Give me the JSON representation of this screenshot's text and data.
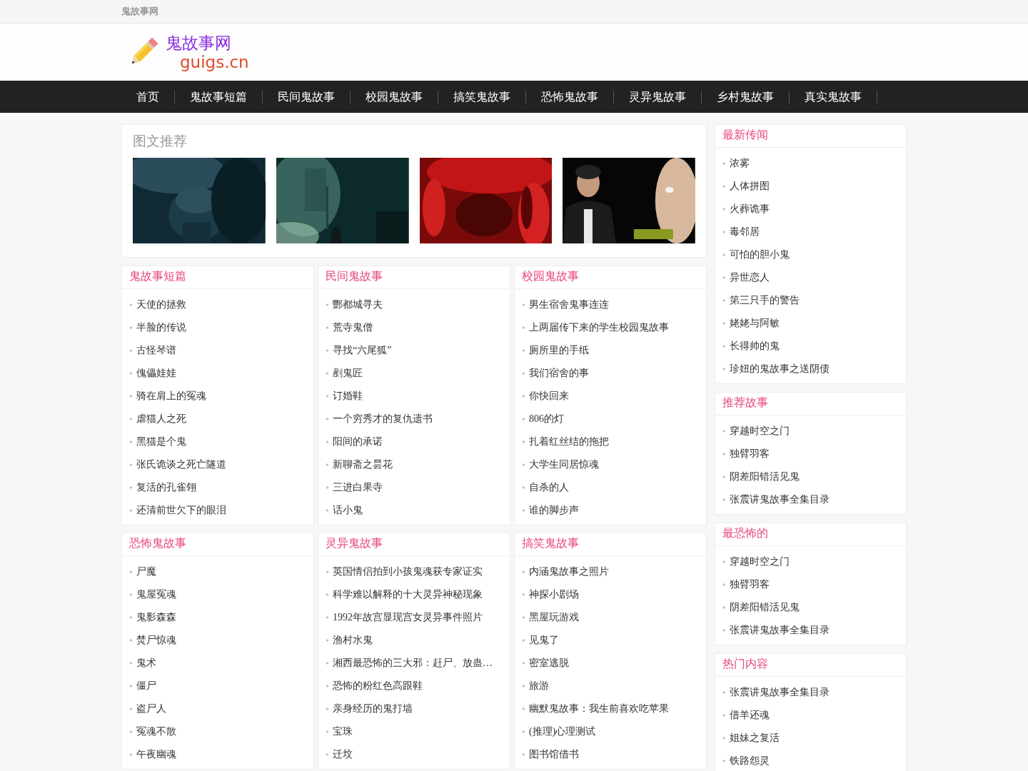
{
  "top_bar": {
    "site_name": "鬼故事网"
  },
  "logo": {
    "title": "鬼故事网",
    "domain": "guigs.cn"
  },
  "nav": [
    {
      "label": "首页"
    },
    {
      "label": "鬼故事短篇"
    },
    {
      "label": "民间鬼故事"
    },
    {
      "label": "校园鬼故事"
    },
    {
      "label": "搞笑鬼故事"
    },
    {
      "label": "恐怖鬼故事"
    },
    {
      "label": "灵异鬼故事"
    },
    {
      "label": "乡村鬼故事"
    },
    {
      "label": "真实鬼故事"
    }
  ],
  "featured": {
    "title": "图文推荐"
  },
  "categories": [
    {
      "title": "鬼故事短篇",
      "items": [
        "天使的拯救",
        "半脸的传说",
        "古怪琴谱",
        "傀儡娃娃",
        "骑在肩上的冤魂",
        "虐猫人之死",
        "黑猫是个鬼",
        "张氏诡谈之死亡隧道",
        "复活的孔雀翎",
        "还清前世欠下的眼泪"
      ]
    },
    {
      "title": "民间鬼故事",
      "items": [
        "酆都城寻夫",
        "荒寺鬼僧",
        "寻找“六尾狐”",
        "剷鬼匠",
        "订婚鞋",
        "一个穷秀才的复仇遗书",
        "阳间的承诺",
        "新聊斋之昙花",
        "三进白果寺",
        "话小鬼"
      ]
    },
    {
      "title": "校园鬼故事",
      "items": [
        "男生宿舍鬼事连连",
        "上两届传下来的学生校园鬼故事",
        "厕所里的手纸",
        "我们宿舍的事",
        "你快回来",
        "806的灯",
        "扎着红丝结的拖把",
        "大学生同居惊魂",
        "自杀的人",
        "谁的脚步声"
      ]
    },
    {
      "title": "恐怖鬼故事",
      "items": [
        "尸魔",
        "鬼屋冤魂",
        "鬼影森森",
        "焚尸惊魂",
        "鬼术",
        "僵尸",
        "盗尸人",
        "冤魂不散",
        "午夜幽魂"
      ]
    },
    {
      "title": "灵异鬼故事",
      "items": [
        "英国情侣拍到小孩鬼魂获专家证实",
        "科学难以解释的十大灵异神秘现象",
        "1992年故宫显现宫女灵异事件照片",
        "渔村水鬼",
        "湘西最恐怖的三大邪：赶尸、放蛊…",
        "恐怖的粉红色高跟鞋",
        "亲身经历的鬼打墙",
        "宝珠",
        "迁坟"
      ]
    },
    {
      "title": "搞笑鬼故事",
      "items": [
        "内涵鬼故事之照片",
        "神探小剧场",
        "黑屋玩游戏",
        "见鬼了",
        "密室逃脱",
        "旅游",
        "幽默鬼故事：我生前喜欢吃苹果",
        "(推理)心理测试",
        "图书馆借书"
      ]
    }
  ],
  "sidebar": [
    {
      "title": "最新传闻",
      "items": [
        "浓雾",
        "人体拼图",
        "火葬诡事",
        "毒邻居",
        "可怕的胆小鬼",
        "异世恋人",
        "第三只手的警告",
        "姥姥与阿敏",
        "长得帅的鬼",
        "珍妞的鬼故事之送阴债"
      ]
    },
    {
      "title": "推荐故事",
      "items": [
        "穿越时空之门",
        "独臂羽客",
        "阴差阳错活见鬼",
        "张震讲鬼故事全集目录"
      ]
    },
    {
      "title": "最恐怖的",
      "items": [
        "穿越时空之门",
        "独臂羽客",
        "阴差阳错活见鬼",
        "张震讲鬼故事全集目录"
      ]
    },
    {
      "title": "热门内容",
      "items": [
        "张震讲鬼故事全集目录",
        "借羊还魂",
        "姐妹之复活",
        "铁路怨灵"
      ]
    }
  ]
}
